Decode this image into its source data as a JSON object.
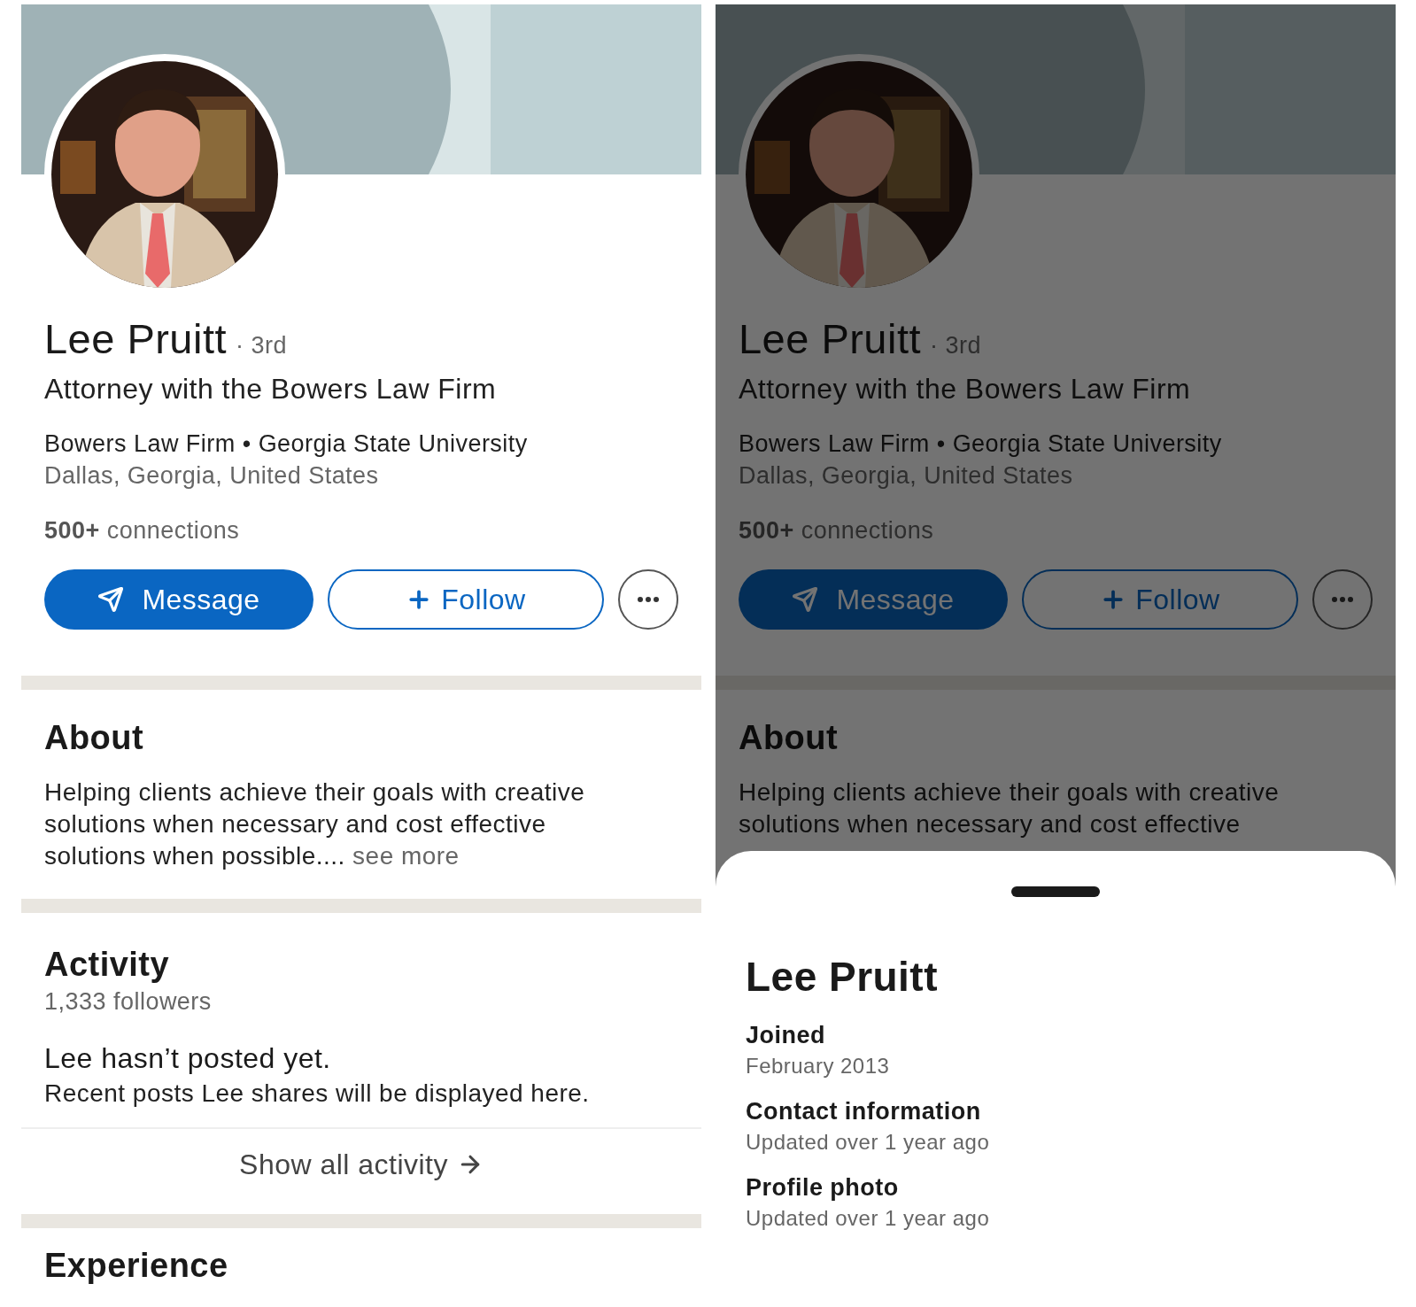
{
  "screens": [
    {
      "dimmed": false,
      "profile": {
        "name": "Lee Pruitt",
        "degree": "· 3rd",
        "headline": "Attorney with the Bowers Law Firm",
        "education_line": "Bowers Law Firm • Georgia State University",
        "location": "Dallas, Georgia, United States",
        "connections_count": "500+",
        "connections_label": "connections",
        "actions": [
          {
            "kind": "message",
            "label": "Message"
          },
          {
            "kind": "follow",
            "label": "Follow"
          },
          {
            "kind": "more"
          }
        ]
      },
      "about": {
        "title": "About",
        "lines": [
          "Helping clients achieve their goals with creative",
          "solutions when necessary and cost effective",
          "solutions when possible...."
        ],
        "see_more": "see more"
      },
      "activity": {
        "title": "Activity",
        "followers": "1,333 followers",
        "empty_title": "Lee hasn’t posted yet.",
        "empty_text": "Recent posts Lee shares will be displayed here.",
        "show_all": "Show all activity"
      },
      "next_section": {
        "title": "Experience"
      }
    },
    {
      "dimmed": true,
      "profile": {
        "name": "Lee Pruitt",
        "degree": "· 3rd",
        "headline": "Attorney with the Bowers Law Firm",
        "education_line": "Bowers Law Firm • Georgia State University",
        "location": "Dallas, Georgia, United States",
        "connections_count": "500+",
        "connections_label": "connections",
        "actions": [
          {
            "kind": "message",
            "label": "Message"
          },
          {
            "kind": "follow",
            "label": "Follow"
          },
          {
            "kind": "more"
          }
        ]
      },
      "about": {
        "title": "About",
        "lines": [
          "Helping clients achieve their goals with creative",
          "solutions when necessary and cost effective"
        ]
      },
      "sheet": {
        "title": "Lee Pruitt",
        "items": [
          {
            "label": "Joined",
            "value": "February 2013"
          },
          {
            "label": "Contact information",
            "value": "Updated over 1 year ago"
          },
          {
            "label": "Profile photo",
            "value": "Updated over 1 year ago"
          }
        ]
      }
    }
  ]
}
